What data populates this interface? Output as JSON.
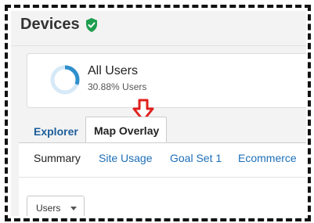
{
  "header": {
    "title": "Devices",
    "verified_icon": "shield-check-icon",
    "verified_color": "#1e9e4f"
  },
  "segment": {
    "name": "All Users",
    "percentage_text": "30.88% Users",
    "donut_fraction": 0.3088,
    "donut_color": "#2e8fcc"
  },
  "annotation": {
    "icon": "arrow-down-outline-icon",
    "color": "#e0201d"
  },
  "tabs": [
    {
      "label": "Explorer",
      "active": false
    },
    {
      "label": "Map Overlay",
      "active": true
    }
  ],
  "subnav": [
    {
      "label": "Summary",
      "active": true
    },
    {
      "label": "Site Usage",
      "active": false
    },
    {
      "label": "Goal Set 1",
      "active": false
    },
    {
      "label": "Ecommerce",
      "active": false
    }
  ],
  "metric_dropdown": {
    "value": "Users",
    "icon": "caret-down-icon"
  }
}
